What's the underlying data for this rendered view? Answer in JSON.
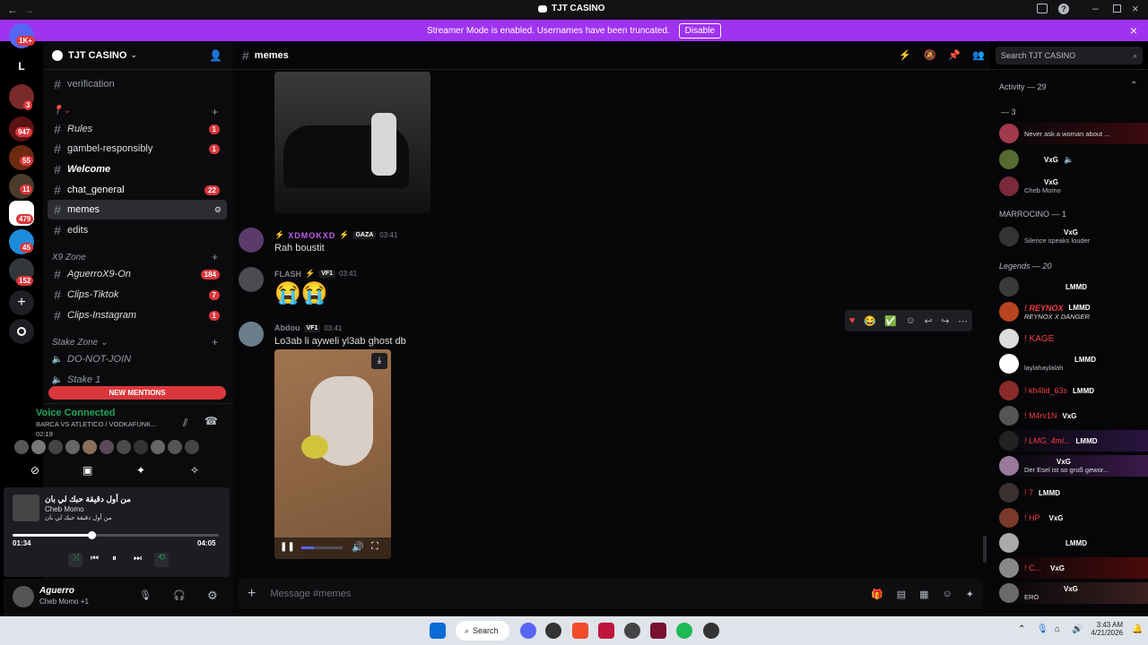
{
  "window": {
    "title": "TJT CASINO"
  },
  "banner": {
    "text": "Streamer Mode is enabled. Usernames have been truncated.",
    "button": "Disable"
  },
  "servers": {
    "dm_badge": "1K+",
    "badges": [
      "3",
      "947",
      "55",
      "11",
      "479",
      "45",
      "152"
    ]
  },
  "server": {
    "name": "TJT CASINO"
  },
  "channels": {
    "top": [
      {
        "name": "verification"
      }
    ],
    "group1": [
      {
        "name": "Rules",
        "count": "1"
      },
      {
        "name": "gambel-responsibly",
        "count": "1"
      },
      {
        "name": "Welcome",
        "count": ""
      },
      {
        "name": "chat_general",
        "count": "22"
      },
      {
        "name": "memes",
        "count": ""
      },
      {
        "name": "edits",
        "count": ""
      }
    ],
    "x9_zone": {
      "label": "X9 Zone",
      "items": [
        {
          "name": "AguerroX9-On",
          "count": "184"
        },
        {
          "name": "Clips-Tiktok",
          "count": "7"
        },
        {
          "name": "Clips-Instagram",
          "count": "1"
        }
      ]
    },
    "stake_zone": {
      "label": "Stake Zone",
      "items": [
        {
          "name": "DO-NOT-JOIN"
        },
        {
          "name": "Stake 1"
        }
      ]
    },
    "new_mentions": "NEW MENTIONS"
  },
  "voice": {
    "status": "Voice Connected",
    "channel": "BARCA VS ATLETICO / VODKAFUNK...",
    "time": "02:19"
  },
  "music": {
    "title": "من أول دقيقة حبك لي بان",
    "artist": "Cheb Momo",
    "album": "من أول دقيقة حبك لي بان",
    "elapsed": "01:34",
    "total": "04:05",
    "progress": 0.384
  },
  "user": {
    "name": "Aguerro",
    "status": "Cheb Momo +1"
  },
  "channel_header": {
    "name": "memes"
  },
  "search": {
    "placeholder": "Search TJT CASINO"
  },
  "messages": [
    {
      "author": "XDMOKXD",
      "tag": "GAZA",
      "time": "03:41",
      "text": "Rah boustit"
    },
    {
      "author": "FLASH",
      "tag": "VF1",
      "time": "03:41",
      "text": "😭😭"
    },
    {
      "author": "Abdou",
      "tag": "VF1",
      "time": "03:41",
      "text": "Lo3ab li ayweli yl3ab ghost db"
    }
  ],
  "composer": {
    "placeholder": "Message #memes"
  },
  "members": {
    "header": "Activity — 29",
    "sections": [
      {
        "label": "— 3",
        "items": [
          {
            "name": "",
            "sub": "Never ask a woman about ..."
          },
          {
            "name": "",
            "tag": "VxG",
            "sub": ""
          },
          {
            "name": "",
            "tag": "VxG",
            "sub": "Cheb Momo"
          }
        ]
      },
      {
        "label": "MARROCINO — 1",
        "items": [
          {
            "name": "",
            "tag": "VxG",
            "sub": "Silence speaks louder"
          }
        ]
      },
      {
        "label": "Legends — 20",
        "items": [
          {
            "name": "",
            "tag": "LMMD",
            "sub": ""
          },
          {
            "name": "! REYNOX",
            "tag": "LMMD",
            "sub": "REYNOX X DANGER"
          },
          {
            "name": "! KAGE",
            "tag": "",
            "sub": ""
          },
          {
            "name": "",
            "tag": "LMMD",
            "sub": "laylahaylalah"
          },
          {
            "name": "! kh4lid_63s",
            "tag": "LMMD",
            "sub": ""
          },
          {
            "name": "! M4rv1N",
            "tag": "VxG",
            "sub": ""
          },
          {
            "name": "! LMG_4mi...",
            "tag": "LMMD",
            "sub": ""
          },
          {
            "name": "",
            "tag": "VxG",
            "sub": "Der Esel ist so groß gewor..."
          },
          {
            "name": "! 7",
            "tag": "LMMD",
            "sub": ""
          },
          {
            "name": "! HP",
            "tag": "VxG",
            "sub": ""
          },
          {
            "name": "",
            "tag": "LMMD",
            "sub": ""
          },
          {
            "name": "! C...",
            "tag": "VxG",
            "sub": ""
          },
          {
            "name": "",
            "tag": "VxG",
            "sub": "ERO"
          }
        ]
      }
    ]
  },
  "taskbar": {
    "search": "Search",
    "time": "3:43 AM",
    "date": "4/21/2026"
  }
}
